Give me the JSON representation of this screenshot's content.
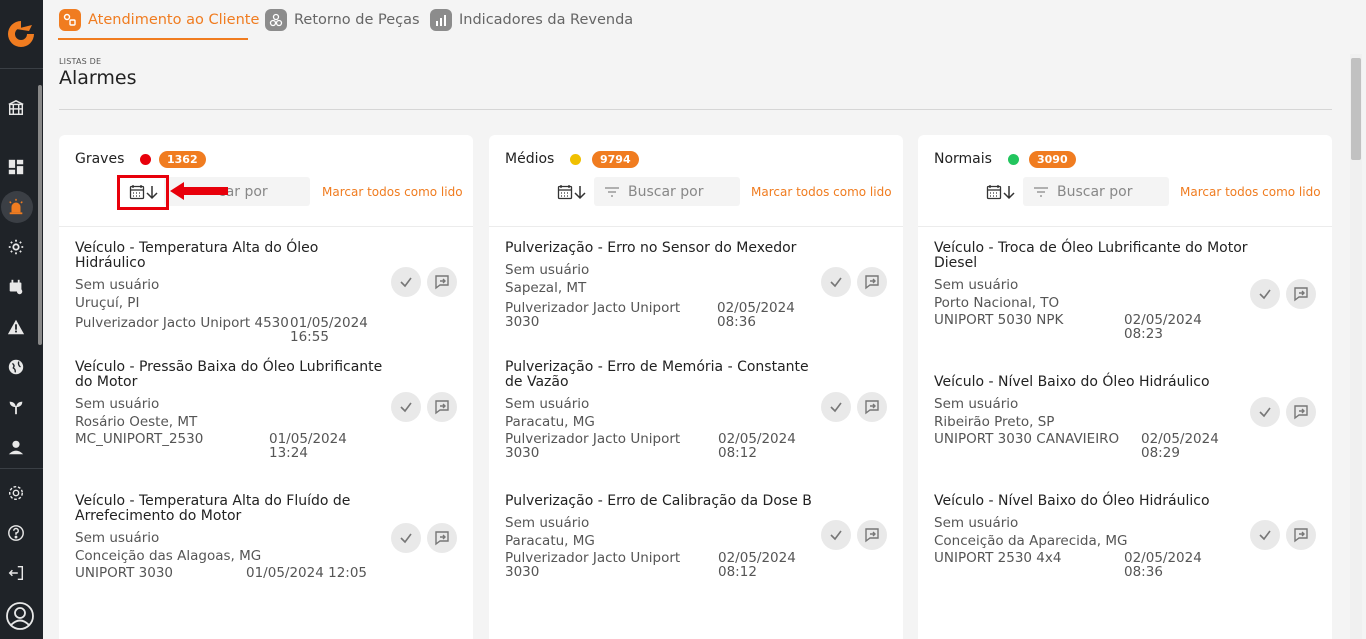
{
  "tabs": [
    {
      "label": "Atendimento ao Cliente",
      "active": true
    },
    {
      "label": "Retorno de Peças",
      "active": false
    },
    {
      "label": "Indicadores da Revenda",
      "active": false
    }
  ],
  "page": {
    "breadcrumb": "LISTAS DE",
    "title": "Alarmes"
  },
  "colors": {
    "accent": "#f07c20",
    "sidebar": "#1f2328",
    "graves_dot": "#e8000b",
    "medios_dot": "#f0c000",
    "normais_dot": "#22c55e",
    "annotation": "#e8000b"
  },
  "columns": [
    {
      "title": "Graves",
      "count": "1362",
      "search_placeholder": "Buscar por",
      "search_visible": "car por",
      "mark_all_label": "Marcar todos como lido",
      "alarms": [
        {
          "title": "Veículo - Temperatura Alta do Óleo Hidráulico",
          "user": "Sem usuário",
          "location": "Uruçuí, PI",
          "machine": "Pulverizador Jacto Uniport 4530",
          "date": "01/05/2024",
          "time": "16:55"
        },
        {
          "title": "Veículo - Pressão Baixa do Óleo Lubrificante do Motor",
          "user": "Sem usuário",
          "location": "Rosário Oeste, MT",
          "machine": "MC_UNIPORT_2530",
          "date": "01/05/2024",
          "time": "13:24"
        },
        {
          "title": "Veículo - Temperatura Alta do Fluído de Arrefecimento do Motor",
          "user": "Sem usuário",
          "location": "Conceição das Alagoas, MG",
          "machine": "UNIPORT 3030",
          "date": "01/05/2024 12:05",
          "time": ""
        }
      ]
    },
    {
      "title": "Médios",
      "count": "9794",
      "search_placeholder": "Buscar por",
      "mark_all_label": "Marcar todos como lido",
      "alarms": [
        {
          "title": "Pulverização - Erro no Sensor do Mexedor",
          "user": "Sem usuário",
          "location": "Sapezal, MT",
          "machine": "Pulverizador Jacto Uniport 3030",
          "date": "02/05/2024",
          "time": "08:36"
        },
        {
          "title": "Pulverização - Erro de Memória - Constante de Vazão",
          "user": "Sem usuário",
          "location": "Paracatu, MG",
          "machine": "Pulverizador Jacto Uniport 3030",
          "date": "02/05/2024",
          "time": "08:12"
        },
        {
          "title": "Pulverização - Erro de Calibração da Dose B",
          "user": "Sem usuário",
          "location": "Paracatu, MG",
          "machine": "Pulverizador Jacto Uniport 3030",
          "date": "02/05/2024",
          "time": "08:12"
        }
      ]
    },
    {
      "title": "Normais",
      "count": "3090",
      "search_placeholder": "Buscar por",
      "mark_all_label": "Marcar todos como lido",
      "alarms": [
        {
          "title": "Veículo - Troca de Óleo Lubrificante do Motor Diesel",
          "user": "Sem usuário",
          "location": "Porto Nacional, TO",
          "machine": "UNIPORT 5030 NPK",
          "date": "02/05/2024",
          "time": "08:23"
        },
        {
          "title": "Veículo - Nível Baixo do Óleo Hidráulico",
          "user": "Sem usuário",
          "location": "Ribeirão Preto, SP",
          "machine": "UNIPORT 3030 CANAVIEIRO",
          "date": "02/05/2024",
          "time": "08:29"
        },
        {
          "title": "Veículo - Nível Baixo do Óleo Hidráulico",
          "user": "Sem usuário",
          "location": "Conceição da Aparecida, MG",
          "machine": "UNIPORT 2530 4x4",
          "date": "02/05/2024",
          "time": "08:36"
        }
      ]
    }
  ]
}
